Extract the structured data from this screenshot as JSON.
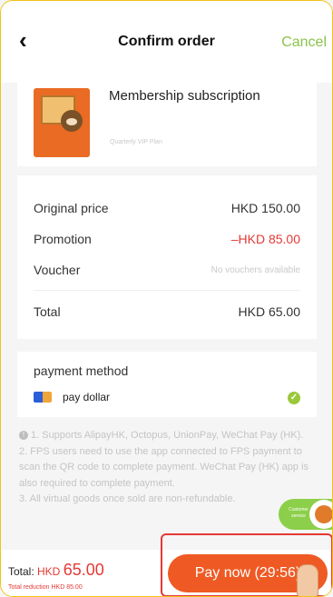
{
  "header": {
    "back_glyph": "‹",
    "title": "Confirm order",
    "cancel": "Cancel"
  },
  "product": {
    "name": "Membership subscription",
    "subtitle": "Quarterly VIP Plan"
  },
  "prices": {
    "original_label": "Original price",
    "original_value": "HKD 150.00",
    "promotion_label": "Promotion",
    "promotion_value": "–HKD 85.00",
    "voucher_label": "Voucher",
    "voucher_value": "No vouchers available",
    "total_label": "Total",
    "total_value": "HKD 65.00"
  },
  "payment": {
    "title": "payment method",
    "method": "pay dollar",
    "check_glyph": "✓"
  },
  "notes": {
    "info_glyph": "!",
    "lines": [
      "1. Supports AlipayHK, Octopus, UnionPay, WeChat Pay (HK).",
      "2. FPS users need to use the app connected to FPS payment to scan the QR code to complete payment. WeChat Pay (HK) app is also required to complete payment.",
      "3. All virtual goods once sold are non-refundable."
    ]
  },
  "customer_service": {
    "label": "Customer service"
  },
  "bottom": {
    "total_prefix": "Total: ",
    "total_currency": "HKD ",
    "total_amount": "65.00",
    "reduction": "Total reduction HKD 85.00",
    "pay_button": "Pay now (29:56)"
  },
  "colors": {
    "accent_green": "#8bc34a",
    "price_red": "#e53935",
    "button_orange": "#ef5a24",
    "frame_yellow": "#f3c319"
  }
}
